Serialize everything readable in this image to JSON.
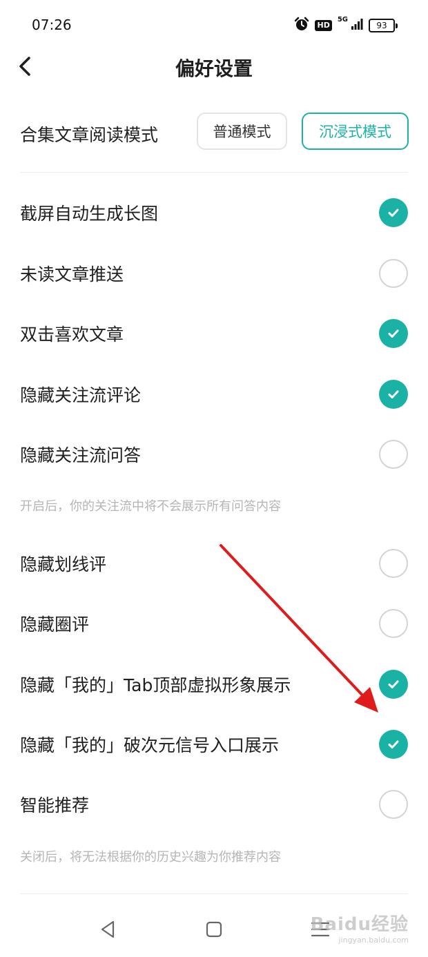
{
  "status_bar": {
    "time": "07:26",
    "hd_label": "HD",
    "network_label": "5G",
    "battery_level": "93"
  },
  "header": {
    "title": "偏好设置"
  },
  "reading_mode": {
    "label": "合集文章阅读模式",
    "options": [
      "普通模式",
      "沉浸式模式"
    ],
    "selected": "沉浸式模式"
  },
  "settings": [
    {
      "label": "截屏自动生成长图",
      "checked": true
    },
    {
      "label": "未读文章推送",
      "checked": false
    },
    {
      "label": "双击喜欢文章",
      "checked": true
    },
    {
      "label": "隐藏关注流评论",
      "checked": true
    },
    {
      "label": "隐藏关注流问答",
      "checked": false
    },
    {
      "label": "隐藏划线评",
      "checked": false
    },
    {
      "label": "隐藏圈评",
      "checked": false
    },
    {
      "label": "隐藏「我的」Tab顶部虚拟形象展示",
      "checked": true
    },
    {
      "label": "隐藏「我的」破次元信号入口展示",
      "checked": true
    },
    {
      "label": "智能推荐",
      "checked": false
    }
  ],
  "hints": {
    "follow_qa": "开启后，你的关注流中将不会展示所有问答内容",
    "smart_recommend": "关闭后，将无法根据你的历史兴趣为你推荐内容"
  },
  "watermark": {
    "main": "Baidu经验",
    "sub": "jingyan.baidu.com"
  },
  "colors": {
    "accent": "#1ab2a4",
    "annotation_arrow": "#e01b1b"
  }
}
